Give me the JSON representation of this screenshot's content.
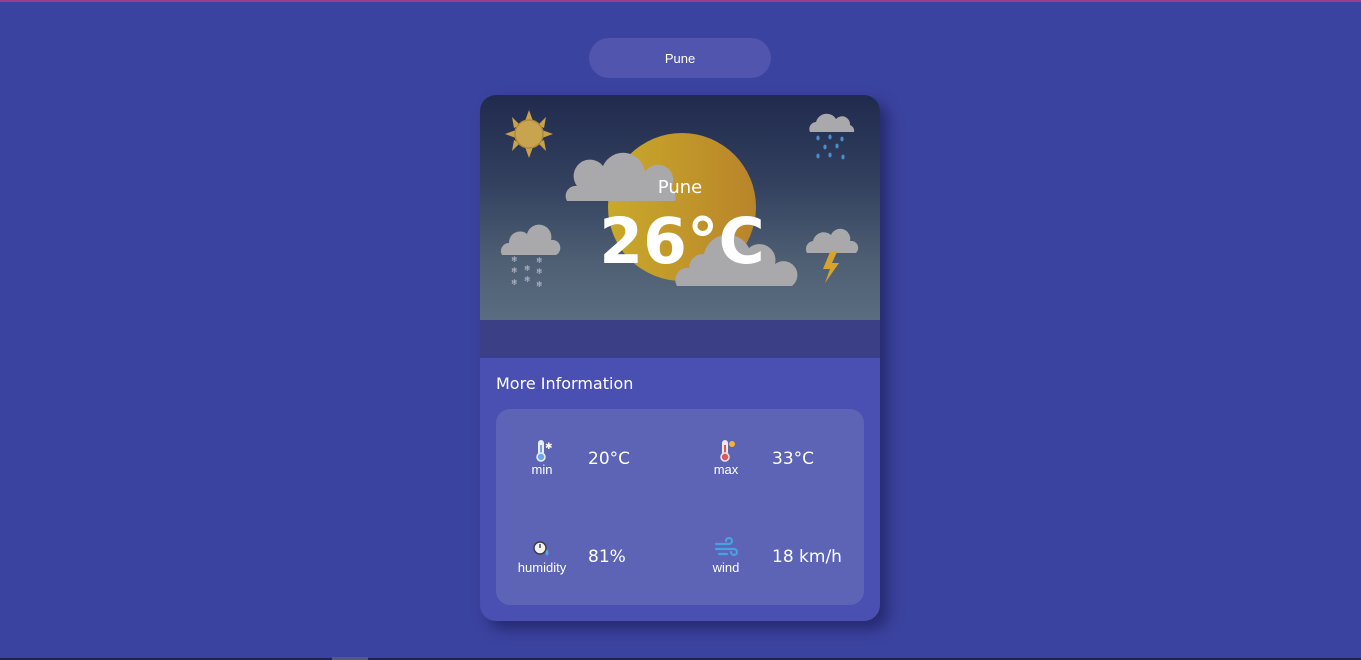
{
  "search": {
    "value": "Pune"
  },
  "weather": {
    "city": "Pune",
    "temperature": "26°C"
  },
  "more_info": {
    "title": "More Information",
    "metrics": [
      {
        "label": "min",
        "value": "20°C",
        "icon": "thermometer-cold-icon"
      },
      {
        "label": "max",
        "value": "33°C",
        "icon": "thermometer-hot-icon"
      },
      {
        "label": "humidity",
        "value": "81%",
        "icon": "humidity-gauge-icon"
      },
      {
        "label": "wind",
        "value": "18 km/h",
        "icon": "wind-icon"
      }
    ]
  },
  "colors": {
    "background": "#3b43a0",
    "card": "#4a50b1",
    "panel": "#5d64b6",
    "sun": "#d4a326",
    "cloud": "#a9a9ab"
  }
}
